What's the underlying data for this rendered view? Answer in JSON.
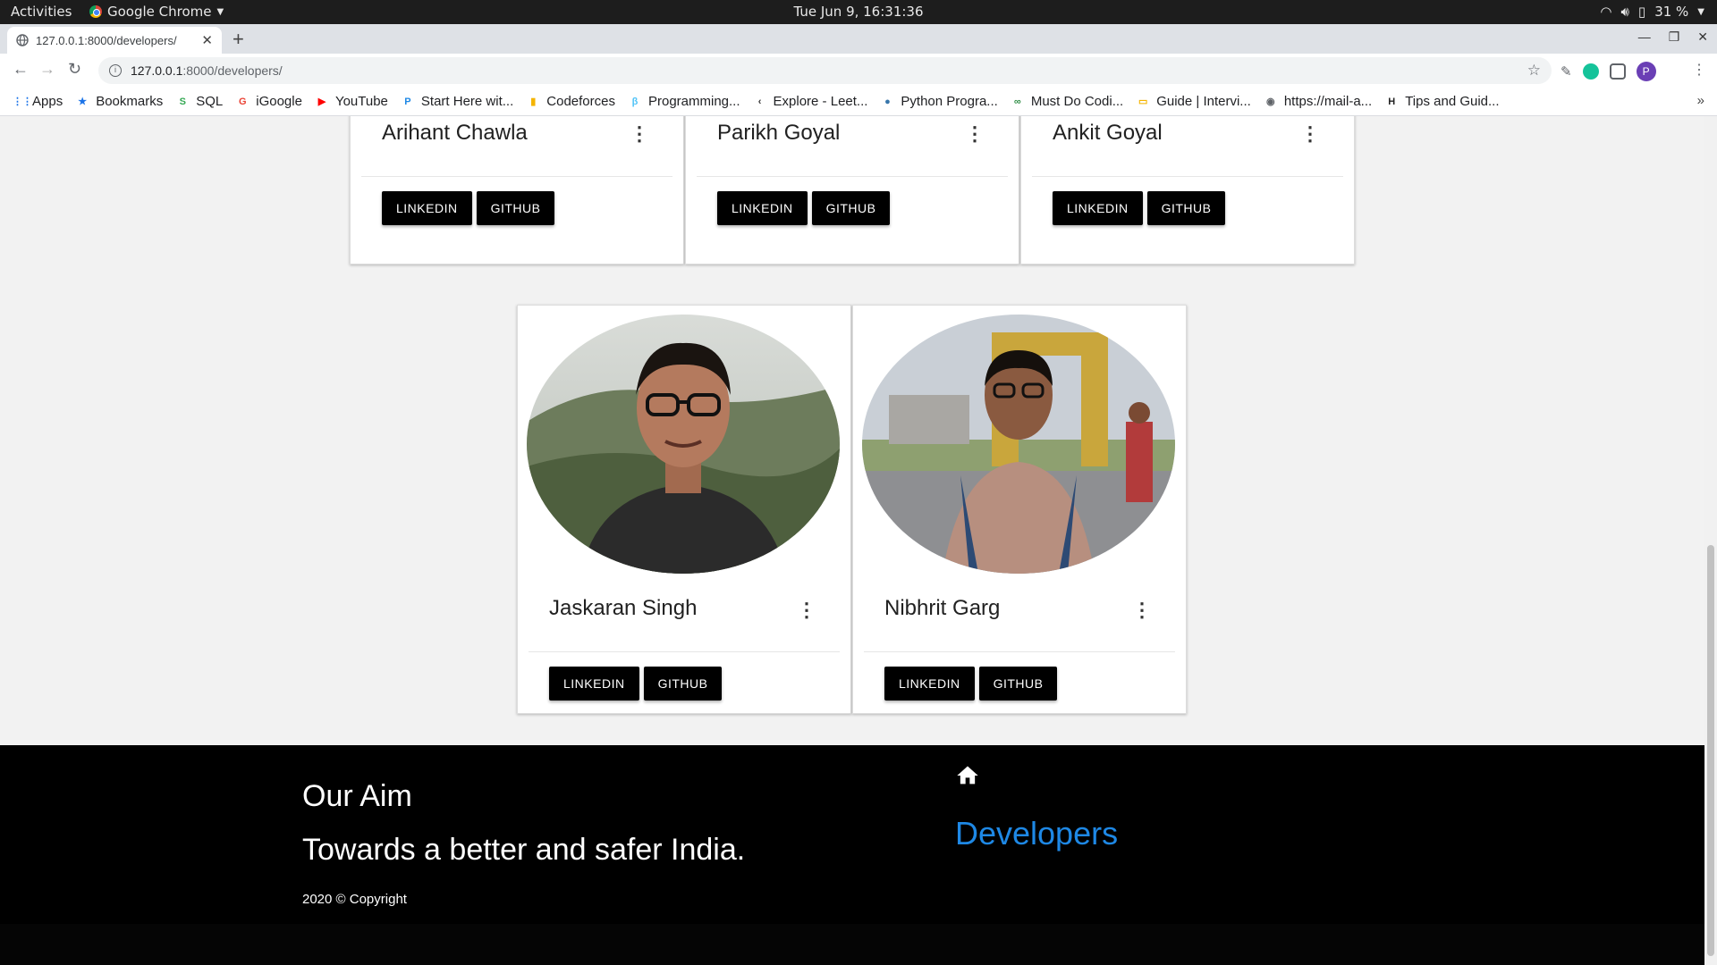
{
  "topbar": {
    "activities": "Activities",
    "app_name": "Google Chrome",
    "clock": "Tue Jun  9, 16:31:36",
    "battery": "31 %"
  },
  "browser": {
    "tab_title": "127.0.0.1:8000/developers/",
    "url_host": "127.0.0.1",
    "url_path": ":8000/developers/",
    "profile_initial": "P"
  },
  "bookmarks": [
    {
      "label": "Apps",
      "icon": "apps-grid-icon",
      "color": "#1a73e8"
    },
    {
      "label": "Bookmarks",
      "icon": "star-icon",
      "color": "#1a73e8"
    },
    {
      "label": "SQL",
      "icon": "sql-icon",
      "color": "#34a853"
    },
    {
      "label": "iGoogle",
      "icon": "google-icon",
      "color": "#ea4335"
    },
    {
      "label": "YouTube",
      "icon": "youtube-icon",
      "color": "#ff0000"
    },
    {
      "label": "Start Here wit...",
      "icon": "p-icon",
      "color": "#1e88e5"
    },
    {
      "label": "Codeforces",
      "icon": "codeforces-icon",
      "color": "#f4b400"
    },
    {
      "label": "Programming...",
      "icon": "beta-icon",
      "color": "#4fc3f7"
    },
    {
      "label": "Explore - Leet...",
      "icon": "leetcode-icon",
      "color": "#333333"
    },
    {
      "label": "Python Progra...",
      "icon": "python-icon",
      "color": "#3776ab"
    },
    {
      "label": "Must Do Codi...",
      "icon": "gfg-icon",
      "color": "#2f8d46"
    },
    {
      "label": "Guide | Intervi...",
      "icon": "doc-icon",
      "color": "#f4b400"
    },
    {
      "label": "https://mail-a...",
      "icon": "globe-icon",
      "color": "#5f6368"
    },
    {
      "label": "Tips and Guid...",
      "icon": "hackerearth-icon",
      "color": "#222222"
    }
  ],
  "developers_row1": [
    {
      "name": "Arihant Chawla",
      "linkedin": "LINKEDIN",
      "github": "GITHUB"
    },
    {
      "name": "Parikh Goyal",
      "linkedin": "LINKEDIN",
      "github": "GITHUB"
    },
    {
      "name": "Ankit Goyal",
      "linkedin": "LINKEDIN",
      "github": "GITHUB"
    }
  ],
  "developers_row2": [
    {
      "name": "Jaskaran Singh",
      "linkedin": "LINKEDIN",
      "github": "GITHUB"
    },
    {
      "name": "Nibhrit Garg",
      "linkedin": "LINKEDIN",
      "github": "GITHUB"
    }
  ],
  "footer": {
    "aim_title": "Our Aim",
    "aim_text": "Towards a better and safer India.",
    "copyright": "2020 © Copyright",
    "home_icon": "home-icon",
    "developers_link": "Developers",
    "link_color": "#1e88e5"
  }
}
